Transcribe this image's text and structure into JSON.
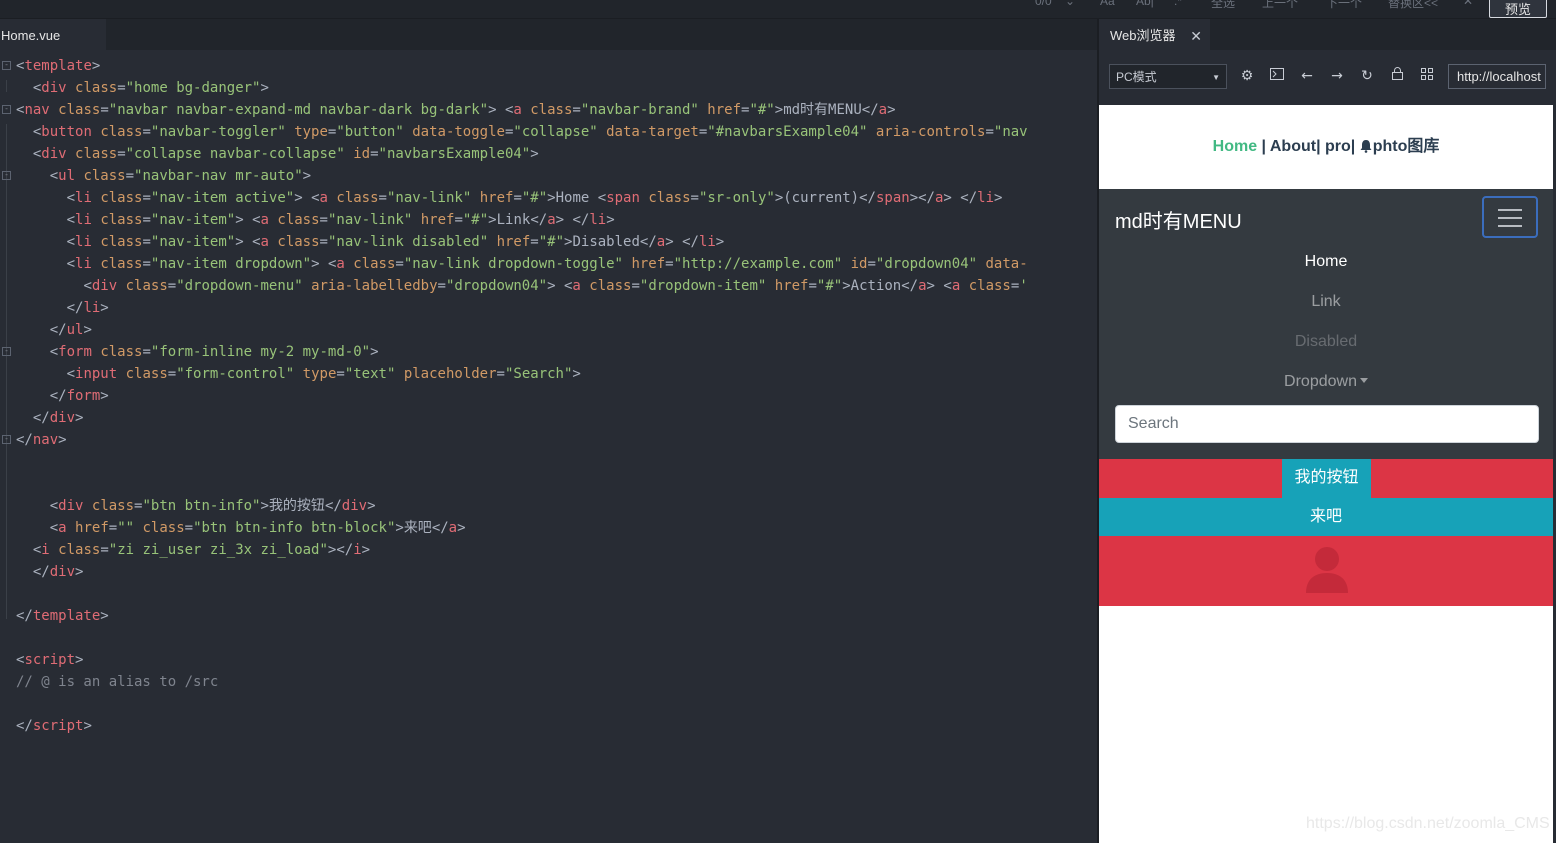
{
  "toolbar": {
    "match_count": "0/0",
    "match_case": "Aa",
    "whole_word": "Ab|",
    "regex": ".*",
    "select_all": "全选",
    "prev": "上一个",
    "next": "下一个",
    "replace": "替换区<<",
    "close": "✕",
    "preview": "预览"
  },
  "editor": {
    "tab_label": "Home.vue"
  },
  "browser": {
    "tab_label": "Web浏览器",
    "tab_close": "✕",
    "mode": "PC模式",
    "url": "http://localhost",
    "icons": [
      "settings-icon",
      "console-icon",
      "back-icon",
      "forward-icon",
      "reload-icon",
      "lock-icon",
      "qrcode-icon"
    ]
  },
  "page": {
    "nav": {
      "home": "Home",
      "sep1": " | ",
      "about": "About",
      "sep2": "| ",
      "pro": "pro",
      "sep3": "| ",
      "photo": "phto图库"
    },
    "brand": "md时有MENU",
    "links": {
      "home": "Home",
      "link": "Link",
      "disabled": "Disabled",
      "dropdown": "Dropdown"
    },
    "search_placeholder": "Search",
    "button": "我的按钮",
    "block_button": "来吧"
  },
  "watermark": "https://blog.csdn.net/zoomla_CMS",
  "colors": {
    "editor_bg": "#282c34",
    "vue_green": "#42b983",
    "navbar_dark": "#343a40",
    "danger": "#dc3545",
    "info": "#17a2b8"
  }
}
